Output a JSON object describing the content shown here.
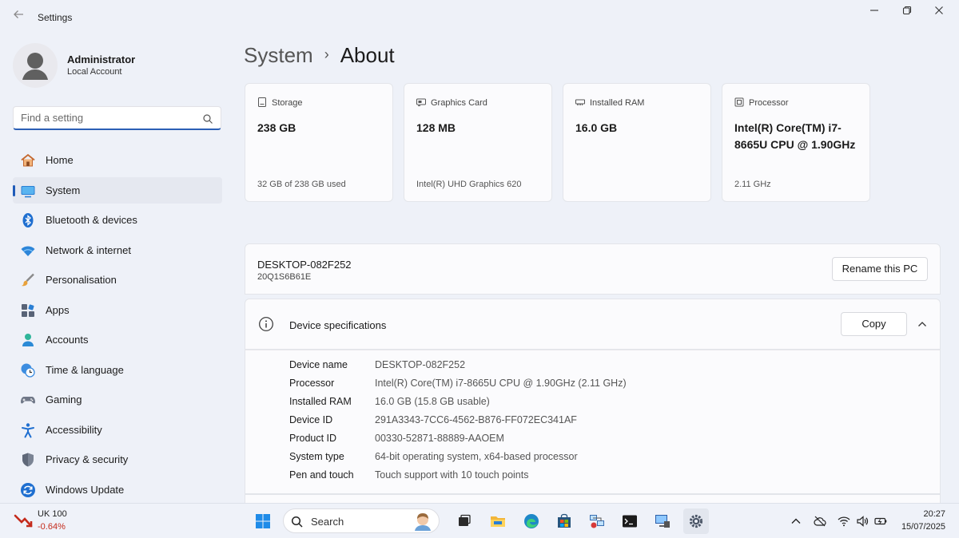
{
  "window": {
    "title": "Settings",
    "back_icon": "arrow-left-icon",
    "minimize_icon": "minimize-icon",
    "restore_icon": "restore-icon",
    "close_icon": "close-icon"
  },
  "user": {
    "name": "Administrator",
    "account_type": "Local Account"
  },
  "search": {
    "placeholder": "Find a setting"
  },
  "nav": {
    "items": [
      {
        "label": "Home",
        "icon": "home-icon",
        "active": false
      },
      {
        "label": "System",
        "icon": "system-icon",
        "active": true
      },
      {
        "label": "Bluetooth & devices",
        "icon": "bluetooth-icon",
        "active": false
      },
      {
        "label": "Network & internet",
        "icon": "wifi-icon",
        "active": false
      },
      {
        "label": "Personalisation",
        "icon": "brush-icon",
        "active": false
      },
      {
        "label": "Apps",
        "icon": "apps-icon",
        "active": false
      },
      {
        "label": "Accounts",
        "icon": "accounts-icon",
        "active": false
      },
      {
        "label": "Time & language",
        "icon": "clock-globe-icon",
        "active": false
      },
      {
        "label": "Gaming",
        "icon": "gamepad-icon",
        "active": false
      },
      {
        "label": "Accessibility",
        "icon": "accessibility-icon",
        "active": false
      },
      {
        "label": "Privacy & security",
        "icon": "shield-icon",
        "active": false
      },
      {
        "label": "Windows Update",
        "icon": "update-icon",
        "active": false
      }
    ]
  },
  "breadcrumb": {
    "parent": "System",
    "separator": "›",
    "current": "About"
  },
  "cards": [
    {
      "title": "Storage",
      "icon": "storage-icon",
      "value": "238 GB",
      "sub": "32 GB of 238 GB used"
    },
    {
      "title": "Graphics Card",
      "icon": "graphics-card-icon",
      "value": "128 MB",
      "sub": "Intel(R) UHD Graphics 620"
    },
    {
      "title": "Installed RAM",
      "icon": "ram-icon",
      "value": "16.0 GB",
      "sub": ""
    },
    {
      "title": "Processor",
      "icon": "processor-icon",
      "value": "Intel(R) Core(TM) i7-8665U CPU @ 1.90GHz",
      "sub": "2.11 GHz"
    }
  ],
  "pc": {
    "name": "DESKTOP-082F252",
    "model": "20Q1S6B61E",
    "rename_label": "Rename this PC"
  },
  "specs": {
    "title": "Device specifications",
    "copy_label": "Copy",
    "rows": [
      {
        "key": "Device name",
        "value": "DESKTOP-082F252"
      },
      {
        "key": "Processor",
        "value": "Intel(R) Core(TM) i7-8665U CPU @ 1.90GHz (2.11 GHz)"
      },
      {
        "key": "Installed RAM",
        "value": "16.0 GB (15.8 GB usable)"
      },
      {
        "key": "Device ID",
        "value": "291A3343-7CC6-4562-B876-FF072EC341AF"
      },
      {
        "key": "Product ID",
        "value": "00330-52871-88889-AAOEM"
      },
      {
        "key": "System type",
        "value": "64-bit operating system, x64-based processor"
      },
      {
        "key": "Pen and touch",
        "value": "Touch support with 10 touch points"
      }
    ]
  },
  "taskbar": {
    "stock_name": "UK 100",
    "stock_change": "-0.64%",
    "search_label": "Search",
    "apps": [
      "start-icon",
      "task-view-icon",
      "file-explorer-icon",
      "edge-icon",
      "store-icon",
      "network-tool-icon",
      "terminal-icon",
      "remote-desktop-icon",
      "settings-icon"
    ],
    "tray": [
      "chevron-up-icon",
      "cloud-icon",
      "wifi-icon",
      "speaker-icon",
      "battery-icon"
    ],
    "time": "20:27",
    "date": "15/07/2025"
  },
  "colors": {
    "accent": "#1f5bb8",
    "background": "#eef1f8",
    "card": "#fbfbfd",
    "negative": "#c42b1c"
  }
}
